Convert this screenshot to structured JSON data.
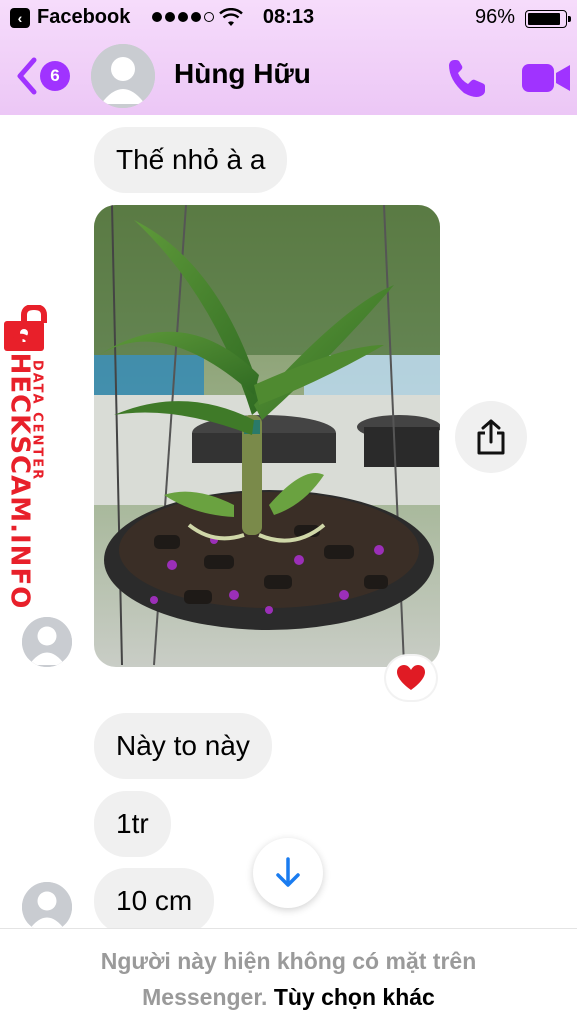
{
  "status_bar": {
    "back_app_label": "Facebook",
    "time": "08:13",
    "battery_percent": "96%",
    "signal_bars_filled": 4,
    "signal_bars_total": 5
  },
  "header": {
    "back_badge_count": "6",
    "contact_name": "Hùng Hữu",
    "accent_color": "#a033ff"
  },
  "messages": [
    {
      "text": "Thế nhỏ à a"
    },
    {
      "text": "Này to này"
    },
    {
      "text": "1tr"
    },
    {
      "text": "10 cm"
    }
  ],
  "photo_message": {
    "reaction": "heart"
  },
  "watermark": {
    "title": "CHECKSCAM.INFO",
    "subtitle": "DATA CENTER"
  },
  "footer": {
    "notice": "Người này hiện không có mặt trên",
    "notice_tail": "Messenger.",
    "link": "Tùy chọn khác"
  }
}
